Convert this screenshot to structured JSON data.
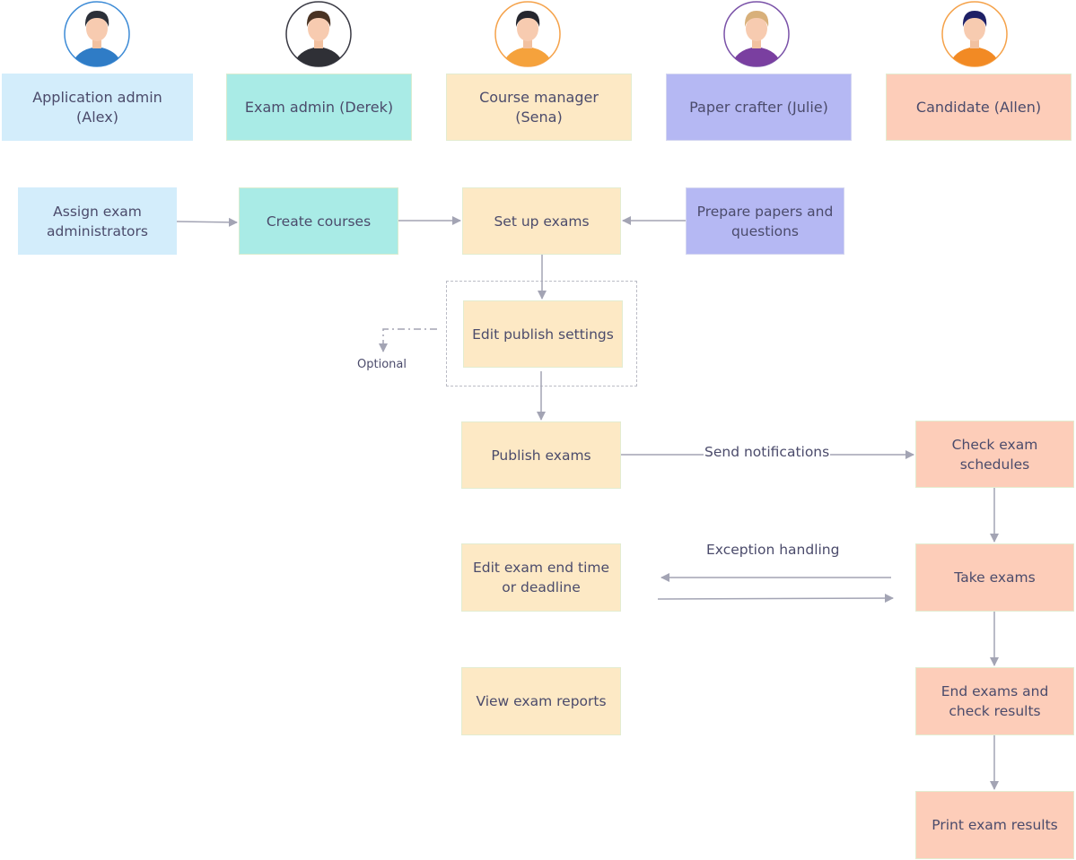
{
  "roles": [
    {
      "label": "Application admin (Alex)",
      "ring": "#3d8bd6",
      "hair": "#2b2f38",
      "shirt": "#2f7cc6"
    },
    {
      "label": "Exam admin (Derek)",
      "ring": "#3a3a44",
      "hair": "#4a3323",
      "shirt": "#2f3036"
    },
    {
      "label": "Course manager (Sena)",
      "ring": "#f5a24a",
      "hair": "#25262e",
      "shirt": "#f5a23c"
    },
    {
      "label": "Paper crafter (Julie)",
      "ring": "#7a52a8",
      "hair": "#d8b07a",
      "shirt": "#7a3fa0"
    },
    {
      "label": "Candidate (Allen)",
      "ring": "#f5a24a",
      "hair": "#1e2066",
      "shirt": "#f28a24"
    }
  ],
  "steps": {
    "assign": "Assign exam administrators",
    "create_courses": "Create courses",
    "set_up": "Set up exams",
    "prepare": "Prepare papers and questions",
    "edit_publish": "Edit publish settings",
    "publish": "Publish exams",
    "check_schedules": "Check exam schedules",
    "edit_end_time": "Edit exam end time or deadline",
    "take": "Take exams",
    "view_reports": "View exam reports",
    "end_exams": "End exams and check results",
    "print": "Print exam results"
  },
  "labels": {
    "optional": "Optional",
    "send_notifications": "Send notifications",
    "exception_handling": "Exception handling"
  },
  "colors": {
    "arrow": "#a3a4b4",
    "text": "#4b4b6b"
  }
}
